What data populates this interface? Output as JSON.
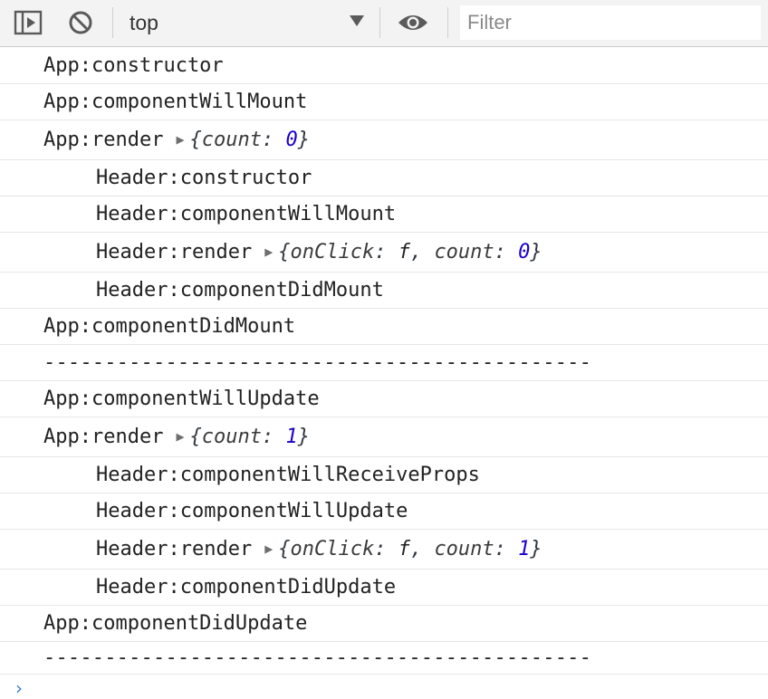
{
  "toolbar": {
    "context": "top",
    "filter_placeholder": "Filter"
  },
  "colors": {
    "number": "#1c00cf",
    "prompt": "#3a7bd5",
    "toolbar_bg": "#f3f3f3"
  },
  "messages": [
    {
      "text": "App:constructor"
    },
    {
      "text": "App:componentWillMount"
    },
    {
      "text": "App:render",
      "object": {
        "items": [
          {
            "key": "count",
            "value": "0"
          }
        ]
      }
    },
    {
      "text": "Header:constructor"
    },
    {
      "text": "Header:componentWillMount"
    },
    {
      "text": "Header:render",
      "object": {
        "items": [
          {
            "key": "onClick",
            "value": "f"
          },
          {
            "key": "count",
            "value": "0"
          }
        ]
      }
    },
    {
      "text": "Header:componentDidMount"
    },
    {
      "text": "App:componentDidMount"
    },
    {
      "text": "---------------------------------------------"
    },
    {
      "text": "App:componentWillUpdate"
    },
    {
      "text": "App:render",
      "object": {
        "items": [
          {
            "key": "count",
            "value": "1"
          }
        ]
      }
    },
    {
      "text": "Header:componentWillReceiveProps"
    },
    {
      "text": "Header:componentWillUpdate"
    },
    {
      "text": "Header:render",
      "object": {
        "items": [
          {
            "key": "onClick",
            "value": "f"
          },
          {
            "key": "count",
            "value": "1"
          }
        ]
      }
    },
    {
      "text": "Header:componentDidUpdate"
    },
    {
      "text": "App:componentDidUpdate"
    },
    {
      "text": "---------------------------------------------"
    }
  ]
}
